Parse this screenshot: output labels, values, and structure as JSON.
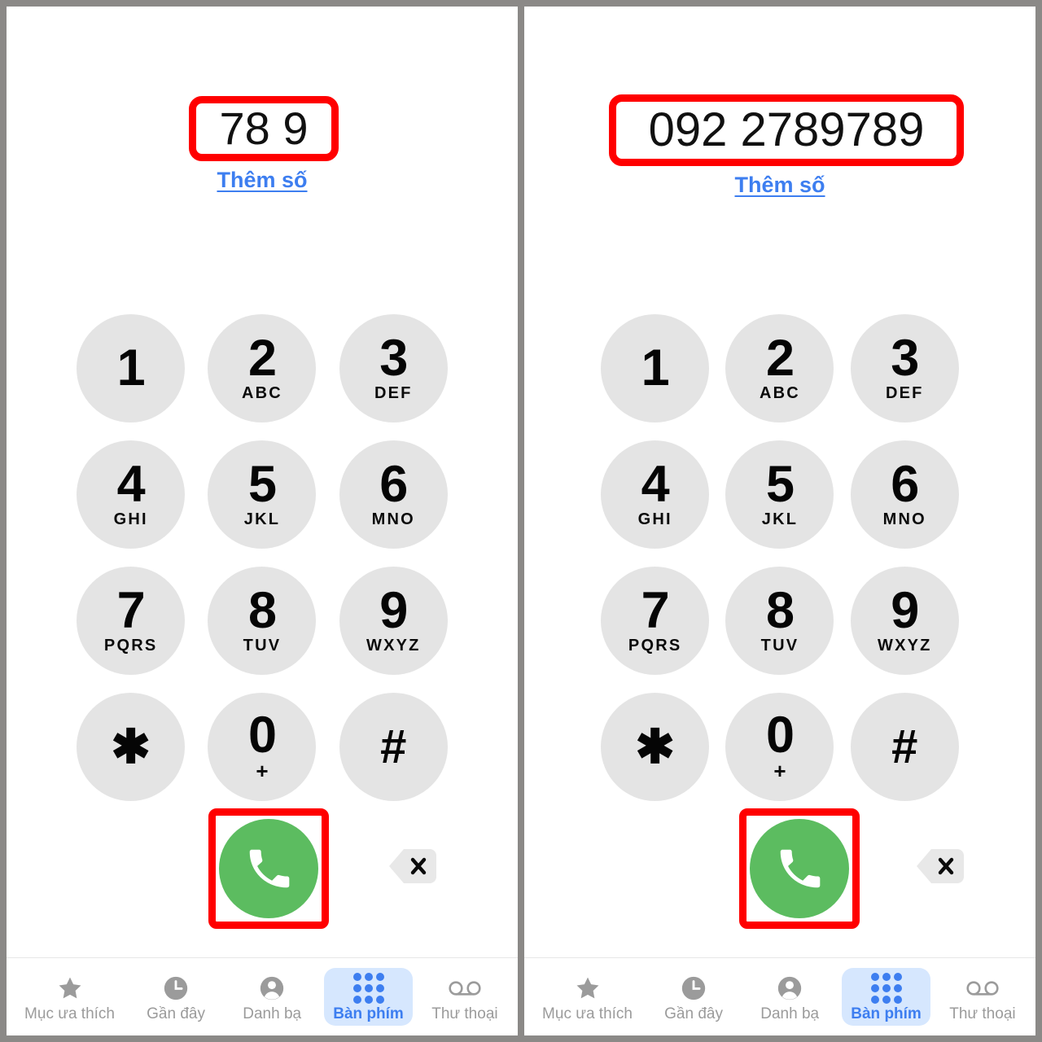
{
  "frame": {
    "border_color": "#8b8987",
    "panel_background": "#ffffff"
  },
  "theme": {
    "accent_blue": "#3d7ef0",
    "active_tab_pill": "#d6e7fe",
    "call_green": "#5cbc60",
    "key_gray": "#e4e4e4",
    "highlight_red": "#ff0000",
    "icon_gray": "#9b9b9b"
  },
  "panels": [
    {
      "id": "left",
      "display": {
        "dialed_number": "78 9",
        "add_number_label": "Thêm số",
        "highlighted": true
      }
    },
    {
      "id": "right",
      "display": {
        "dialed_number": "092 2789789",
        "add_number_label": "Thêm số",
        "highlighted": true
      }
    }
  ],
  "keypad": {
    "keys": [
      {
        "digit": "1",
        "letters": ""
      },
      {
        "digit": "2",
        "letters": "ABC"
      },
      {
        "digit": "3",
        "letters": "DEF"
      },
      {
        "digit": "4",
        "letters": "GHI"
      },
      {
        "digit": "5",
        "letters": "JKL"
      },
      {
        "digit": "6",
        "letters": "MNO"
      },
      {
        "digit": "7",
        "letters": "PQRS"
      },
      {
        "digit": "8",
        "letters": "TUV"
      },
      {
        "digit": "9",
        "letters": "WXYZ"
      },
      {
        "digit": "✱",
        "letters": ""
      },
      {
        "digit": "0",
        "letters": "+"
      },
      {
        "digit": "#",
        "letters": ""
      }
    ]
  },
  "actions": {
    "call_button_icon": "phone-handset-icon",
    "backspace_icon": "backspace-delete-icon"
  },
  "tabbar": {
    "items": [
      {
        "label": "Mục ưa thích",
        "icon": "star-icon",
        "active": false
      },
      {
        "label": "Gần đây",
        "icon": "clock-icon",
        "active": false
      },
      {
        "label": "Danh bạ",
        "icon": "person-icon",
        "active": false
      },
      {
        "label": "Bàn phím",
        "icon": "keypad-dots-icon",
        "active": true
      },
      {
        "label": "Thư thoại",
        "icon": "voicemail-icon",
        "active": false
      }
    ]
  }
}
